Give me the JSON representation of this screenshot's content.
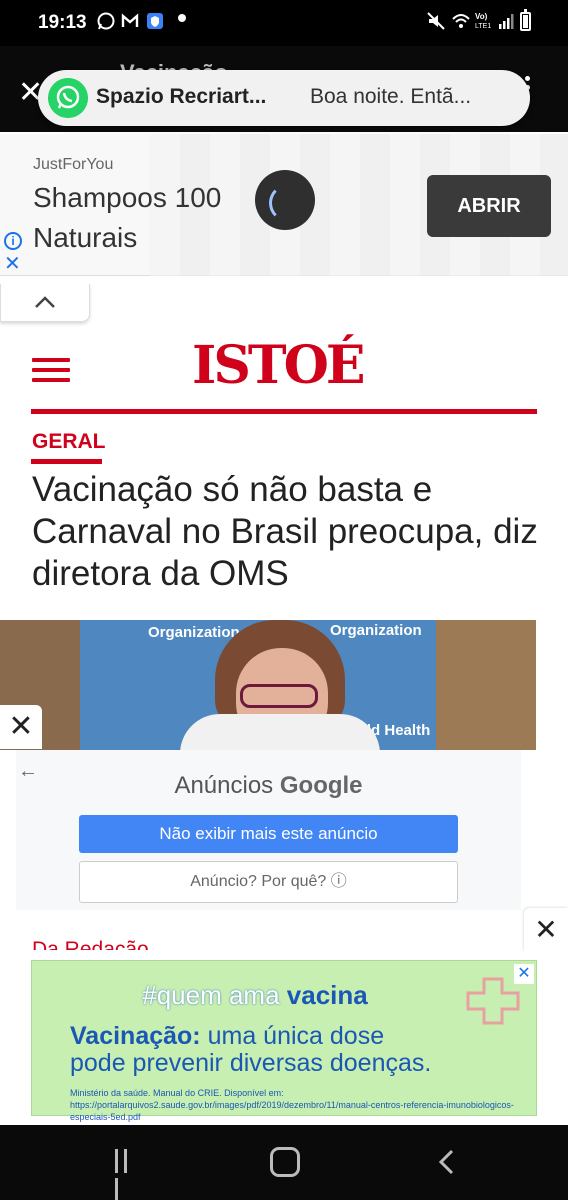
{
  "status_bar": {
    "time": "19:13"
  },
  "topbar": {
    "title": "Vacinação"
  },
  "notification": {
    "sender": "Spazio Recriart...",
    "message": "Boa noite. Entã..."
  },
  "top_ad": {
    "brand": "JustForYou",
    "headline": "Shampoos 100 Naturais",
    "button": "ABRIR"
  },
  "site": {
    "logo": "ISTOÉ"
  },
  "article": {
    "section": "GERAL",
    "headline": "Vacinação só não basta e Carnaval no Brasil preocupa, diz diretora da OMS",
    "byline": "Da Redação"
  },
  "photo": {
    "org_text_1": "Organization",
    "org_text_2": "Organization",
    "org_text_3": "World Health"
  },
  "google_ad": {
    "title_prefix": "Anúncios",
    "title_brand": "Google",
    "stop_button": "Não exibir mais este anúncio",
    "why_button": "Anúncio? Por quê? ⓘ"
  },
  "bottom_ad": {
    "hashtag_prefix": "#quem ama",
    "hashtag_bold": "vacina",
    "line1_bold": "Vacinação:",
    "line1_rest": "uma única dose",
    "line2": "pode prevenir diversas doenças.",
    "source": "Ministério da saúde. Manual do CRIE. Disponível em: https://portalarquivos2.saude.gov.br/images/pdf/2019/dezembro/11/manual-centros-referencia-imunobiologicos-especiais-5ed.pdf"
  },
  "colors": {
    "brand_red": "#d0021b",
    "google_blue": "#4285f4",
    "whatsapp_green": "#25D366",
    "ad_green": "#c7efb1"
  }
}
